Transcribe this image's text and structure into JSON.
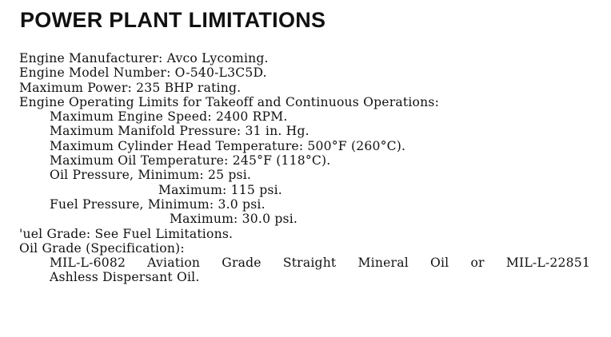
{
  "heading": "POWER PLANT LIMITATIONS",
  "lines": {
    "engine_manufacturer": "Engine Manufacturer: Avco Lycoming.",
    "engine_model": "Engine Model Number: O-540-L3C5D.",
    "max_power": "Maximum Power: 235 BHP rating.",
    "operating_limits": "Engine Operating Limits for Takeoff and Continuous Operations:",
    "max_engine_speed": "Maximum Engine Speed: 2400 RPM.",
    "max_manifold_pressure": "Maximum Manifold Pressure: 31 in. Hg.",
    "max_cht": "Maximum Cylinder Head Temperature: 500°F (260°C).",
    "max_oil_temp": "Maximum Oil Temperature: 245°F (118°C).",
    "oil_pressure_min": "Oil Pressure, Minimum: 25 psi.",
    "oil_pressure_max": "Maximum: 115 psi.",
    "fuel_pressure_min": "Fuel Pressure, Minimum: 3.0 psi.",
    "fuel_pressure_max": "Maximum: 30.0 psi.",
    "fuel_grade": "'uel Grade: See Fuel Limitations.",
    "oil_grade": "Oil Grade (Specification):",
    "oil_spec_1": "MIL-L-6082 Aviation Grade Straight Mineral Oil or MIL-L-22851",
    "oil_spec_2": "Ashless Dispersant Oil."
  }
}
